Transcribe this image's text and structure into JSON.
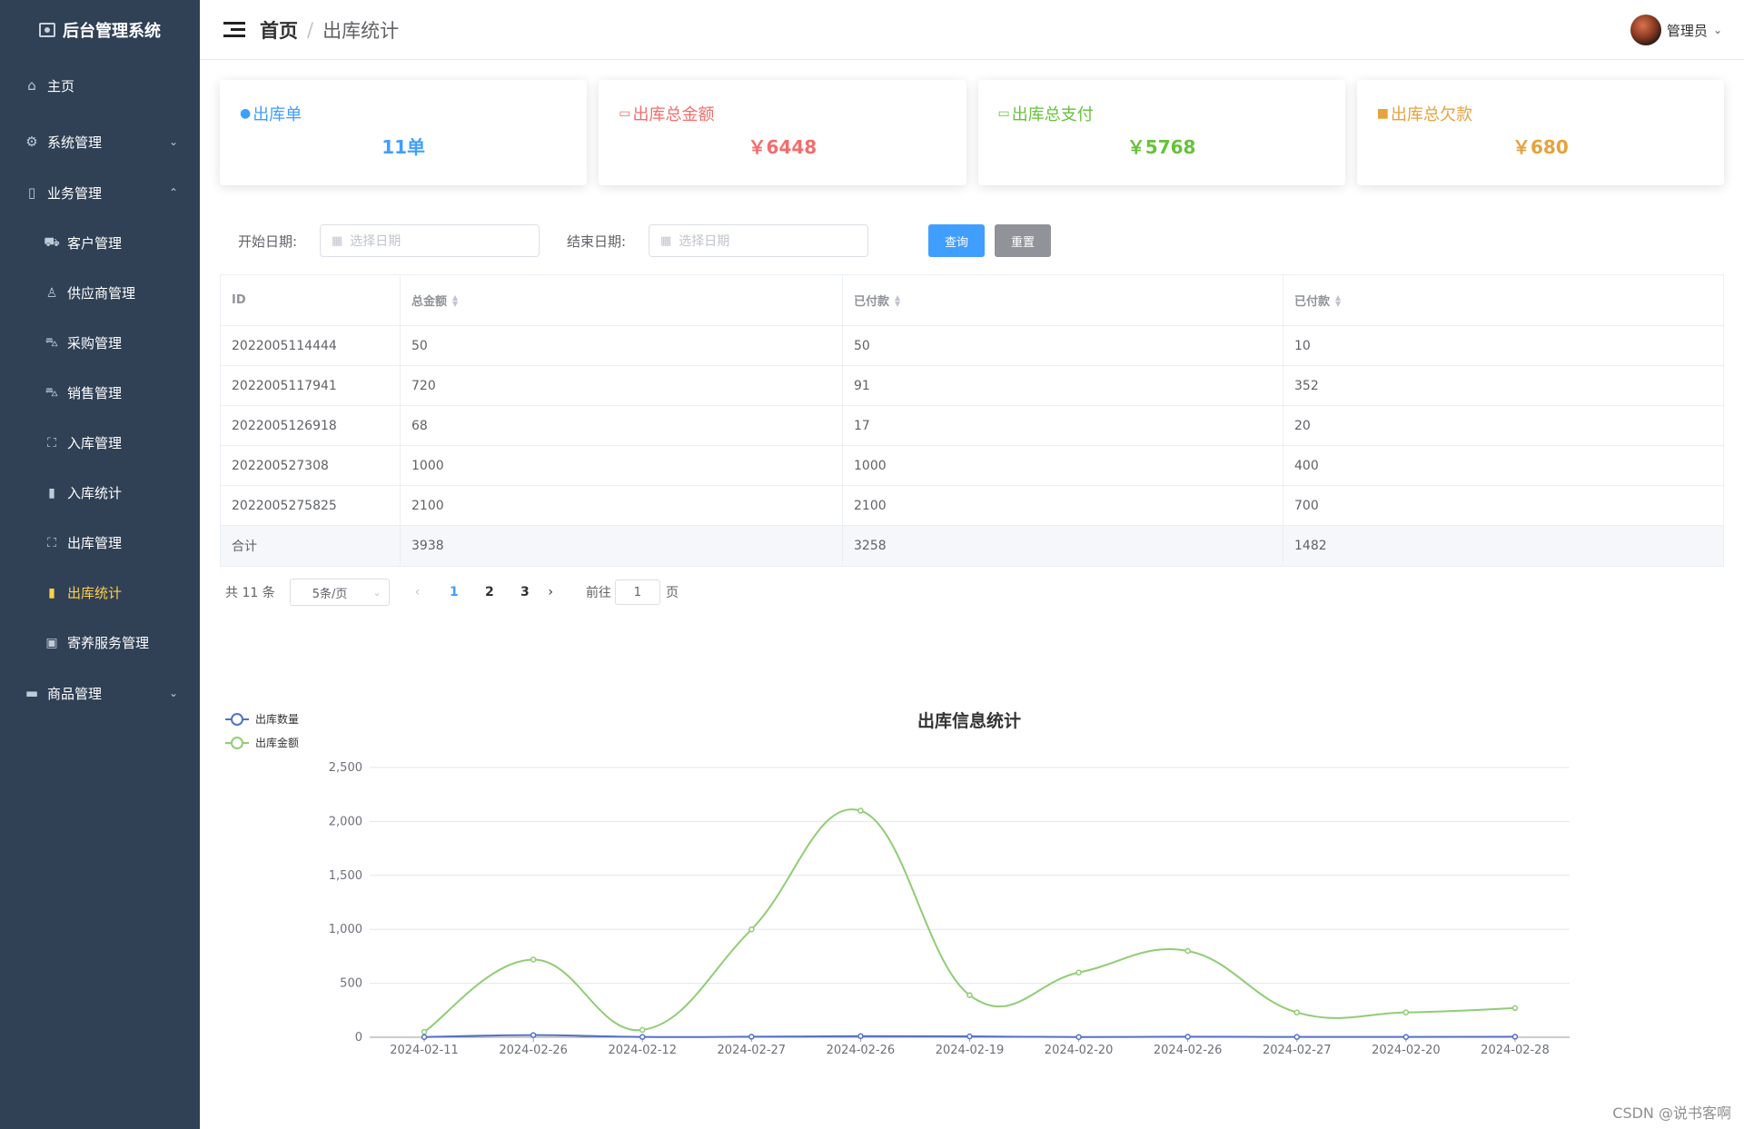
{
  "sidebar": {
    "brand": "后台管理系统",
    "items": [
      {
        "label": "主页",
        "icon": "home-icon"
      },
      {
        "label": "系统管理",
        "icon": "gear-icon",
        "expanded": false
      },
      {
        "label": "业务管理",
        "icon": "document-icon",
        "expanded": true,
        "children": [
          {
            "label": "客户管理",
            "icon": "truck-icon"
          },
          {
            "label": "供应商管理",
            "icon": "user-icon"
          },
          {
            "label": "采购管理",
            "icon": "cart-icon"
          },
          {
            "label": "销售管理",
            "icon": "cart-icon"
          },
          {
            "label": "入库管理",
            "icon": "bag-icon"
          },
          {
            "label": "入库统计",
            "icon": "bar-chart-icon"
          },
          {
            "label": "出库管理",
            "icon": "bag-icon"
          },
          {
            "label": "出库统计",
            "icon": "bar-chart-icon",
            "active": true
          },
          {
            "label": "寄养服务管理",
            "icon": "box-icon"
          }
        ]
      },
      {
        "label": "商品管理",
        "icon": "goods-icon",
        "expanded": false
      }
    ]
  },
  "header": {
    "breadcrumb_home": "首页",
    "breadcrumb_sep": "/",
    "breadcrumb_current": "出库统计",
    "user_name": "管理员"
  },
  "cards": [
    {
      "title": "出库单",
      "value": "11单",
      "color": "#409eff",
      "icon": "user-icon"
    },
    {
      "title": "出库总金额",
      "value": "￥6448",
      "color": "#f56c6c",
      "icon": "money-icon"
    },
    {
      "title": "出库总支付",
      "value": "￥5768",
      "color": "#67c23a",
      "icon": "wallet-icon"
    },
    {
      "title": "出库总欠款",
      "value": "￥680",
      "color": "#e6a23c",
      "icon": "debt-icon"
    }
  ],
  "filter": {
    "start_label": "开始日期:",
    "start_placeholder": "选择日期",
    "end_label": "结束日期:",
    "end_placeholder": "选择日期",
    "search_btn": "查询",
    "reset_btn": "重置"
  },
  "table": {
    "headers": [
      "ID",
      "总金额",
      "已付款",
      "已付款"
    ],
    "rows": [
      [
        "2022005114444",
        "50",
        "50",
        "10"
      ],
      [
        "2022005117941",
        "720",
        "91",
        "352"
      ],
      [
        "2022005126918",
        "68",
        "17",
        "20"
      ],
      [
        "202200527308",
        "1000",
        "1000",
        "400"
      ],
      [
        "2022005275825",
        "2100",
        "2100",
        "700"
      ]
    ],
    "summary": [
      "合计",
      "3938",
      "3258",
      "1482"
    ]
  },
  "pagination": {
    "total_text": "共 11 条",
    "page_size": "5条/页",
    "pages": [
      "1",
      "2",
      "3"
    ],
    "current_page": "1",
    "goto_label": "前往",
    "goto_value": "1",
    "goto_suffix": "页",
    "prev": "‹",
    "next": "›"
  },
  "chart_data": {
    "type": "line",
    "title": "出库信息统计",
    "categories": [
      "2024-02-11",
      "2024-02-26",
      "2024-02-12",
      "2024-02-27",
      "2024-02-26",
      "2024-02-19",
      "2024-02-20",
      "2024-02-26",
      "2024-02-27",
      "2024-02-20",
      "2024-02-28"
    ],
    "series": [
      {
        "name": "出库数量",
        "color": "#5470c6",
        "values": [
          2,
          20,
          3,
          5,
          10,
          8,
          2,
          5,
          3,
          3,
          5
        ]
      },
      {
        "name": "出库金额",
        "color": "#91cc75",
        "values": [
          50,
          720,
          68,
          1000,
          2100,
          390,
          600,
          800,
          230,
          230,
          270
        ]
      }
    ],
    "yticks": [
      "0",
      "500",
      "1,000",
      "1,500",
      "2,000",
      "2,500"
    ],
    "ylim": [
      0,
      2500
    ],
    "legend_position": "top-left",
    "grid": true
  },
  "watermark": "CSDN @说书客啊"
}
